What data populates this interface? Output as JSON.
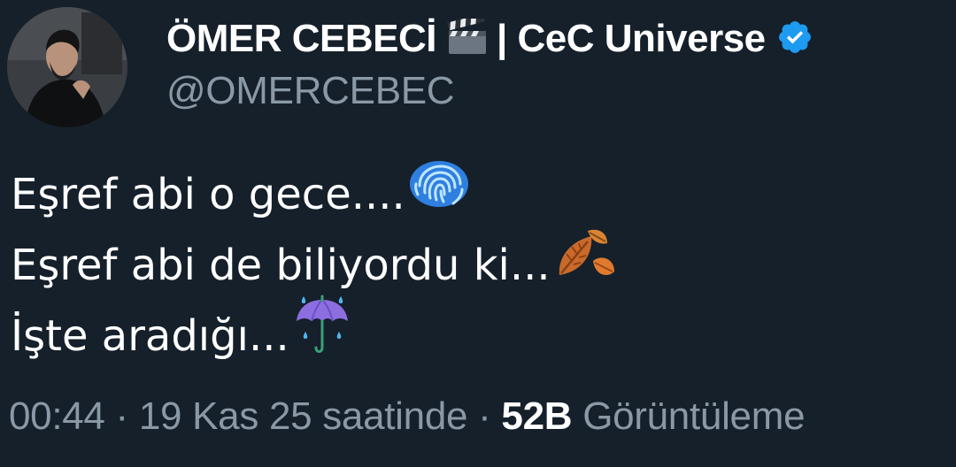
{
  "author": {
    "display_name": "ÖMER CEBECİ",
    "brand": "| CeC Universe",
    "handle": "@OMERCEBEC",
    "icons": [
      "avatar",
      "clapper-board-icon",
      "verified-badge-icon"
    ]
  },
  "tweet": {
    "lines": [
      {
        "text": "Eşref abi o gece....",
        "emoji": "fingerprint-icon"
      },
      {
        "text": "Eşref abi de biliyordu ki...",
        "emoji": "fallen-leaves-icon"
      },
      {
        "text": "İşte aradığı...",
        "emoji": "umbrella-with-rain-icon"
      }
    ]
  },
  "meta": {
    "time": "00:44",
    "separator": "·",
    "date": "19 Kas 25 saatinde",
    "views_count": "52B",
    "views_label": "Görüntüleme"
  },
  "colors": {
    "background": "#15202b",
    "text": "#ffffff",
    "secondary": "#8b98a5",
    "verified": "#1d9bf0"
  }
}
